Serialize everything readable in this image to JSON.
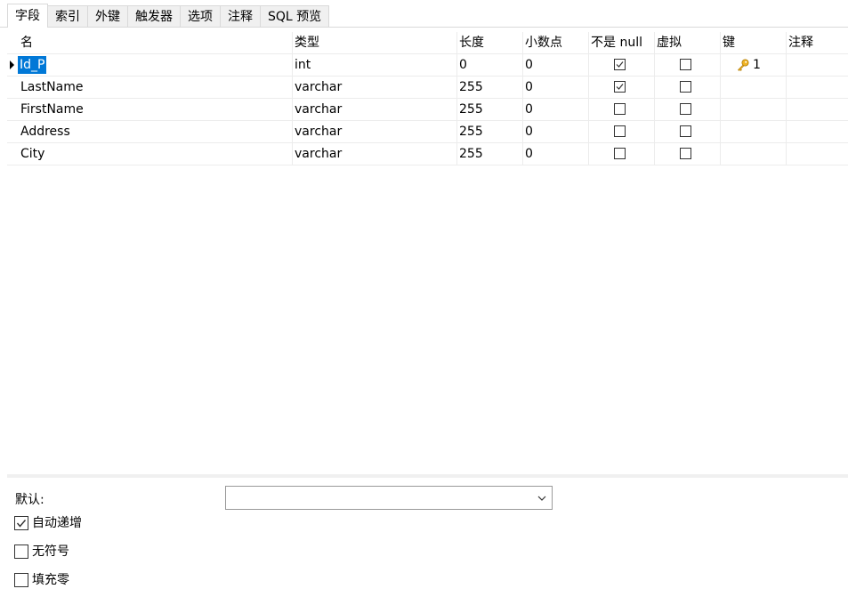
{
  "tabs": [
    "字段",
    "索引",
    "外键",
    "触发器",
    "选项",
    "注释",
    "SQL 预览"
  ],
  "columns": [
    "名",
    "类型",
    "长度",
    "小数点",
    "不是 null",
    "虚拟",
    "键",
    "注释"
  ],
  "rows": [
    {
      "name": "Id_P",
      "type": "int",
      "length": "0",
      "decimals": "0",
      "not_null": true,
      "virtual": false,
      "key": "1",
      "comment": ""
    },
    {
      "name": "LastName",
      "type": "varchar",
      "length": "255",
      "decimals": "0",
      "not_null": true,
      "virtual": false,
      "key": "",
      "comment": ""
    },
    {
      "name": "FirstName",
      "type": "varchar",
      "length": "255",
      "decimals": "0",
      "not_null": false,
      "virtual": false,
      "key": "",
      "comment": ""
    },
    {
      "name": "Address",
      "type": "varchar",
      "length": "255",
      "decimals": "0",
      "not_null": false,
      "virtual": false,
      "key": "",
      "comment": ""
    },
    {
      "name": "City",
      "type": "varchar",
      "length": "255",
      "decimals": "0",
      "not_null": false,
      "virtual": false,
      "key": "",
      "comment": ""
    }
  ],
  "selected_row": 0,
  "bottom": {
    "default_label": "默认:",
    "default_value": "",
    "options": [
      {
        "label": "自动递增",
        "checked": true
      },
      {
        "label": "无符号",
        "checked": false
      },
      {
        "label": "填充零",
        "checked": false
      }
    ]
  },
  "colors": {
    "selection": "#0078d7",
    "key_icon": "#f0b323"
  },
  "icons": {
    "key": "key-icon",
    "row_pointer": "row-pointer-icon",
    "dropdown": "chevron-down-icon"
  }
}
